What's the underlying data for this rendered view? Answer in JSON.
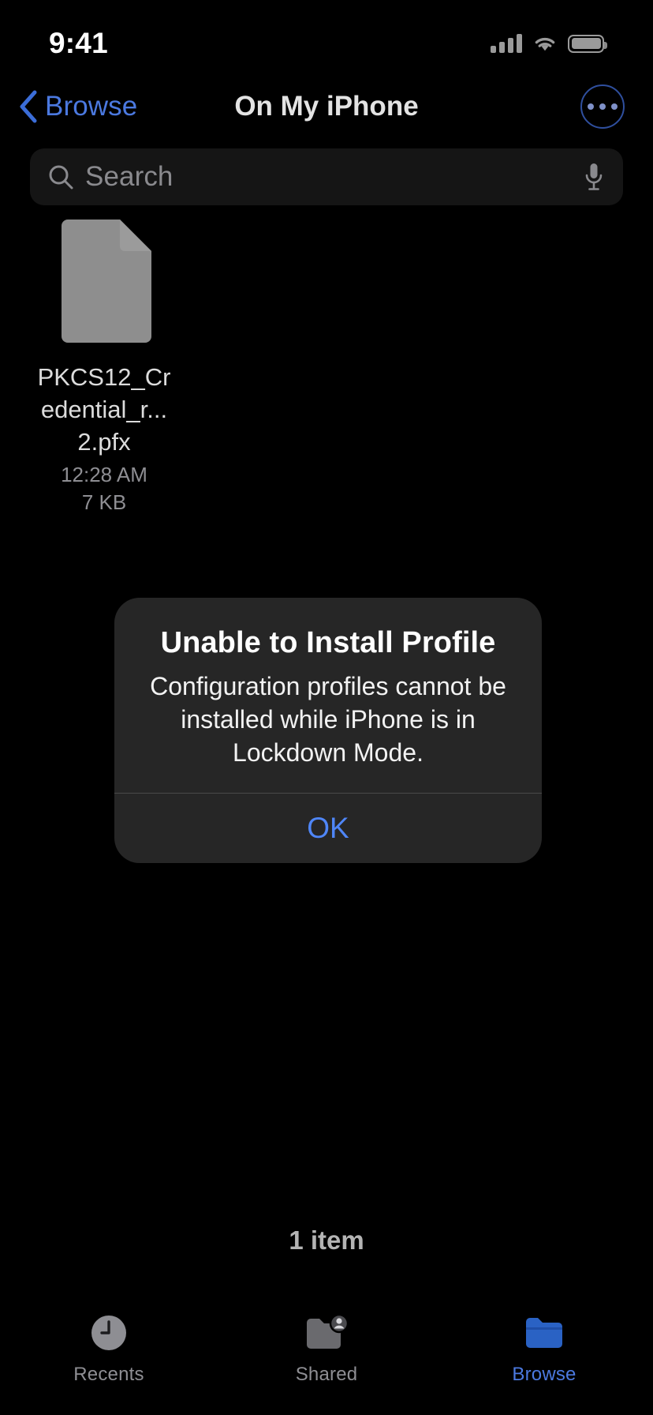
{
  "status_bar": {
    "time": "9:41",
    "signal_icon": "cellular-signal-icon",
    "wifi_icon": "wifi-icon",
    "battery_icon": "battery-icon"
  },
  "nav": {
    "back_label": "Browse",
    "back_icon": "chevron-left-icon",
    "title": "On My iPhone",
    "more_icon": "ellipsis-circle-icon"
  },
  "search": {
    "placeholder": "Search",
    "value": "",
    "search_icon": "search-icon",
    "mic_icon": "microphone-icon"
  },
  "files": [
    {
      "name": "PKCS12_Credential_r...2.pfx",
      "display_name": "PKCS12_Credential_r...2.pfx",
      "date": "12:28 AM",
      "size": "7 KB",
      "icon": "generic-document-icon"
    }
  ],
  "alert": {
    "title": "Unable to Install Profile",
    "message": "Configuration profiles cannot be installed while iPhone is in Lockdown Mode.",
    "ok_label": "OK"
  },
  "footer": {
    "item_count": "1 item"
  },
  "tab_bar": {
    "tabs": [
      {
        "label": "Recents",
        "icon": "clock-icon",
        "active": false
      },
      {
        "label": "Shared",
        "icon": "shared-folder-icon",
        "active": false
      },
      {
        "label": "Browse",
        "icon": "folder-icon",
        "active": true
      }
    ]
  },
  "colors": {
    "accent": "#4b79e0",
    "alert_action": "#4f86f7",
    "background": "#000000",
    "alert_background": "#262626",
    "secondary_text": "#8e8e93",
    "file_icon": "#8e8e8e"
  }
}
